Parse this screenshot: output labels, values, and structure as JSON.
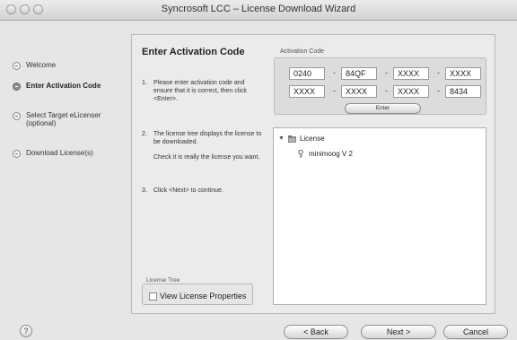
{
  "window": {
    "title": "Syncrosoft LCC – License Download Wizard"
  },
  "sidebar": {
    "items": [
      {
        "label": "Welcome",
        "active": false
      },
      {
        "label": "Enter Activation Code",
        "active": true
      },
      {
        "label": "Select Target eLicenser",
        "sublabel": "(optional)",
        "active": false
      },
      {
        "label": "Download License(s)",
        "active": false
      }
    ]
  },
  "main": {
    "heading": "Enter Activation Code",
    "instructions": [
      {
        "num": "1.",
        "text": "Please enter activation code and ensure that it is correct, then click <Enter>."
      },
      {
        "num": "2.",
        "text": "The license tree displays the license to be downloaded."
      },
      {
        "num": "",
        "text": "Check it is really the license you want."
      },
      {
        "num": "3.",
        "text": "Click <Next> to continue."
      }
    ]
  },
  "activation": {
    "label": "Activation Code",
    "row1": [
      "0240",
      "84QF",
      "XXXX",
      "XXXX"
    ],
    "row2": [
      "XXXX",
      "XXXX",
      "XXXX",
      "8434"
    ],
    "separator": "-",
    "enter_label": "Enter"
  },
  "tree": {
    "root": {
      "label": "License",
      "icon": "folder-icon",
      "expanded": true
    },
    "children": [
      {
        "label": "minimoog V 2",
        "icon": "key-icon"
      }
    ]
  },
  "license_tree": {
    "label": "License Tree",
    "checkbox_label": "View License Properties",
    "checked": false
  },
  "footer": {
    "help": "?",
    "back": "< Back",
    "next": "Next >",
    "cancel": "Cancel"
  }
}
